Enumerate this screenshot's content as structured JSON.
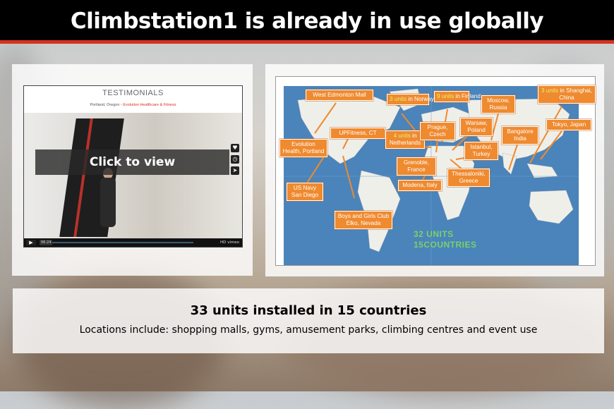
{
  "title": "Climbstation1 is already in use globally",
  "video": {
    "heading": "TESTIMONIALS",
    "location": "Portland, Oregon - ",
    "location_org": "Evolution Healthcare & Fitness",
    "click_label": "Click to view",
    "time": "06:24",
    "brand": "HD vimeo",
    "play_icon": "play-icon"
  },
  "map": {
    "callouts": [
      {
        "id": "west-edmonton",
        "text": "West Edmonton Mall"
      },
      {
        "id": "norway",
        "hi": "3 units",
        "text": " in Norway"
      },
      {
        "id": "finland",
        "hi": "9 units",
        "text": " in Finland"
      },
      {
        "id": "moscow",
        "text": "Moscow, Russia"
      },
      {
        "id": "shanghai",
        "hi": "3 units",
        "text": " in Shanghai, China"
      },
      {
        "id": "upfitness",
        "text": "UPFitness, CT"
      },
      {
        "id": "netherlands",
        "hi": "4 units",
        "text": " in Netherlands"
      },
      {
        "id": "prague",
        "text": "Prague, Czech"
      },
      {
        "id": "warsaw",
        "text": "Warsaw, Poland"
      },
      {
        "id": "bangalore",
        "text": "Bangalore India"
      },
      {
        "id": "tokyo",
        "text": "Tokyo, Japan"
      },
      {
        "id": "evolution",
        "text": "Evolution Health, Portland"
      },
      {
        "id": "istanbul",
        "text": "Istanbul, Turkey"
      },
      {
        "id": "grenoble",
        "text": "Grenoble, France"
      },
      {
        "id": "thessaloniki",
        "text": "Thessaloniki, Greece"
      },
      {
        "id": "modena",
        "text": "Modena, Italy"
      },
      {
        "id": "usnavy",
        "text": "US Navy San Diego"
      },
      {
        "id": "boys",
        "text": "Boys and Girls Club Elko, Nevada"
      }
    ],
    "units_line1": "32 UNITS",
    "units_line2": "15COUNTRIES"
  },
  "summary": {
    "headline": "33 units installed in 15 countries",
    "locations": "Locations include: shopping malls, gyms, amusement parks, climbing centres and event use"
  },
  "colors": {
    "accent": "#d4331f",
    "callout": "#ef8a2f",
    "ocean": "#4a84ba",
    "units": "#7bd06a"
  }
}
